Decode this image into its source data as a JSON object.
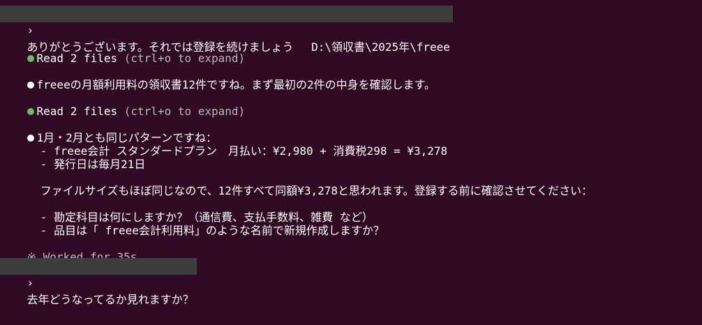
{
  "prompt_1": {
    "marker": "›",
    "text": "ありがとうございます。それでは登録を続けましょう　 D:\\領収書\\2025年\\freee"
  },
  "tool_1": {
    "label": "Read 2 files",
    "hint": "(ctrl+o to expand)"
  },
  "message_1": {
    "text": "freeeの月額利用料の領収書12件ですね。まず最初の2件の中身を確認します。"
  },
  "tool_2": {
    "label": "Read 2 files",
    "hint": "(ctrl+o to expand)"
  },
  "message_2": {
    "lines": [
      "1月・2月とも同じパターンですね：",
      "  - freee会計 スタンダードプラン　月払い：¥2,980 + 消費税298 = ¥3,278",
      "  - 発行日は毎月21日",
      "",
      "  ファイルサイズもほぼ同じなので、12件すべて同額¥3,278と思われます。登録する前に確認させてください：",
      "",
      "  - 勘定科目は何にしますか？（通信費、支払手数料、雑費 など）",
      "  - 品目は「 freee会計利用料」のような名前で新規作成しますか？"
    ]
  },
  "status": {
    "spinner": "※",
    "text": "Worked for 35s"
  },
  "prompt_2": {
    "marker": "›",
    "text": "去年どうなってるか見れますか？"
  },
  "colors": {
    "background": "#300a24",
    "prompt_row": "#3d3d3d",
    "green_dot": "#66bb6a",
    "text": "#ffffff",
    "hint": "#b8b8b8"
  }
}
